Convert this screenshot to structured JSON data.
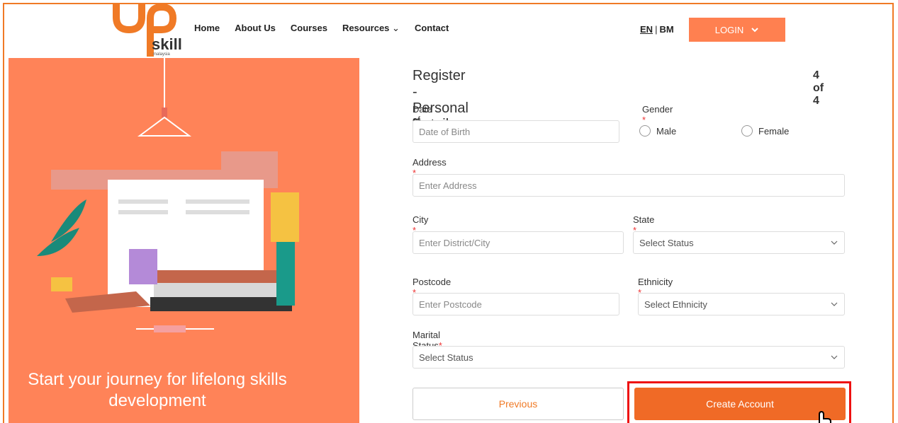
{
  "header": {
    "logo_text": "skill",
    "logo_subtext": "malaysia",
    "nav": [
      "Home",
      "About Us",
      "Courses",
      "Resources",
      "Contact"
    ],
    "lang_en": "EN",
    "lang_sep": "|",
    "lang_bm": "BM",
    "login_label": "LOGIN"
  },
  "hero": {
    "tagline": "Start your journey for lifelong skills development"
  },
  "form": {
    "title": "Register - Personal Details",
    "step": "4 of 4",
    "dob_label": "Date of Birth",
    "dob_placeholder": "Date of Birth",
    "gender_label": "Gender",
    "gender_options": [
      "Male",
      "Female"
    ],
    "address_label": "Address",
    "address_placeholder": "Enter Address",
    "city_label": "City",
    "city_placeholder": "Enter District/City",
    "state_label": "State",
    "state_value": "Select Status",
    "postcode_label": "Postcode",
    "postcode_placeholder": "Enter Postcode",
    "ethnicity_label": "Ethnicity",
    "ethnicity_value": "Select Ethnicity",
    "marital_label": "Marital Status",
    "marital_value": "Select Status",
    "required_mark": "*"
  },
  "buttons": {
    "previous": "Previous",
    "create": "Create Account"
  },
  "colors": {
    "brand": "#f07a26",
    "hero_bg": "#ff8358",
    "highlight": "#e11111"
  }
}
